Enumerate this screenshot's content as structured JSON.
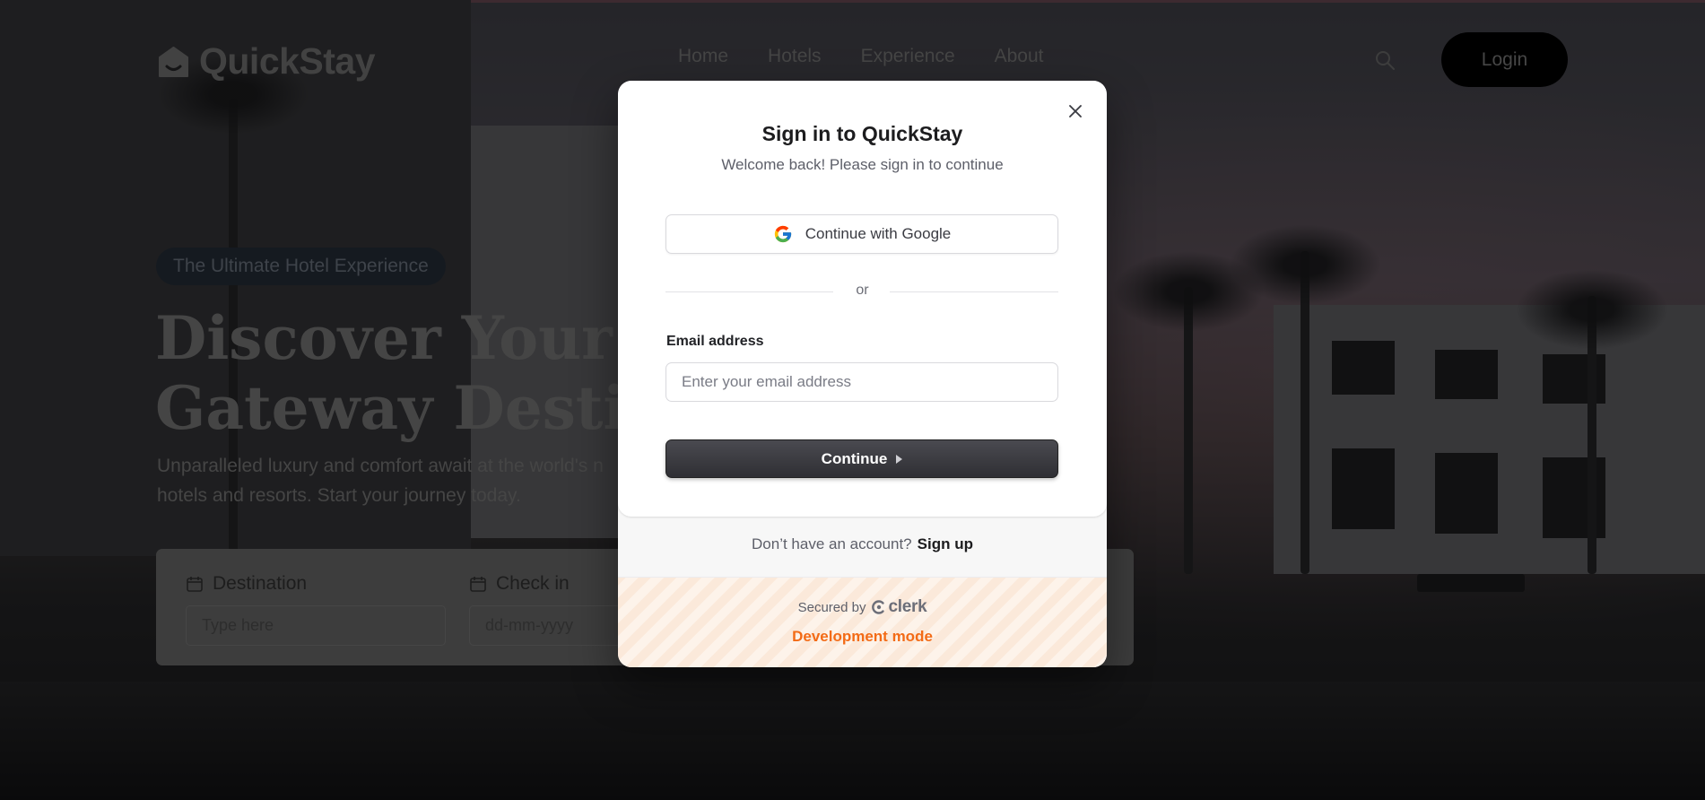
{
  "navbar": {
    "brand": "QuickStay",
    "links": [
      "Home",
      "Hotels",
      "Experience",
      "About"
    ],
    "login_label": "Login"
  },
  "hero": {
    "badge": "The Ultimate Hotel Experience",
    "title_line1": "Discover Your Pe",
    "title_line2": "Gateway Destina",
    "subtitle_line1": "Unparalleled luxury and comfort await at the world's n",
    "subtitle_line2": "hotels and resorts. Start your journey today."
  },
  "search_form": {
    "destination_label": "Destination",
    "destination_placeholder": "Type here",
    "checkin_label": "Check in",
    "checkin_placeholder": "dd-mm-yyyy"
  },
  "modal": {
    "title": "Sign in to QuickStay",
    "subtitle": "Welcome back! Please sign in to continue",
    "google_label": "Continue with Google",
    "divider": "or",
    "email_label": "Email address",
    "email_placeholder": "Enter your email address",
    "continue_label": "Continue",
    "no_account": "Don’t have an account?",
    "sign_up": "Sign up",
    "secured_by": "Secured by",
    "clerk_brand": "clerk",
    "dev_mode": "Development mode"
  },
  "colors": {
    "accent_dev": "#f36b16",
    "button_dark": "#2f2f34",
    "nav_login_bg": "#000000"
  },
  "icons": [
    "home-logo-icon",
    "search-icon",
    "calendar-icon",
    "close-icon",
    "google-icon",
    "caret-right-icon",
    "clerk-logo-icon"
  ]
}
